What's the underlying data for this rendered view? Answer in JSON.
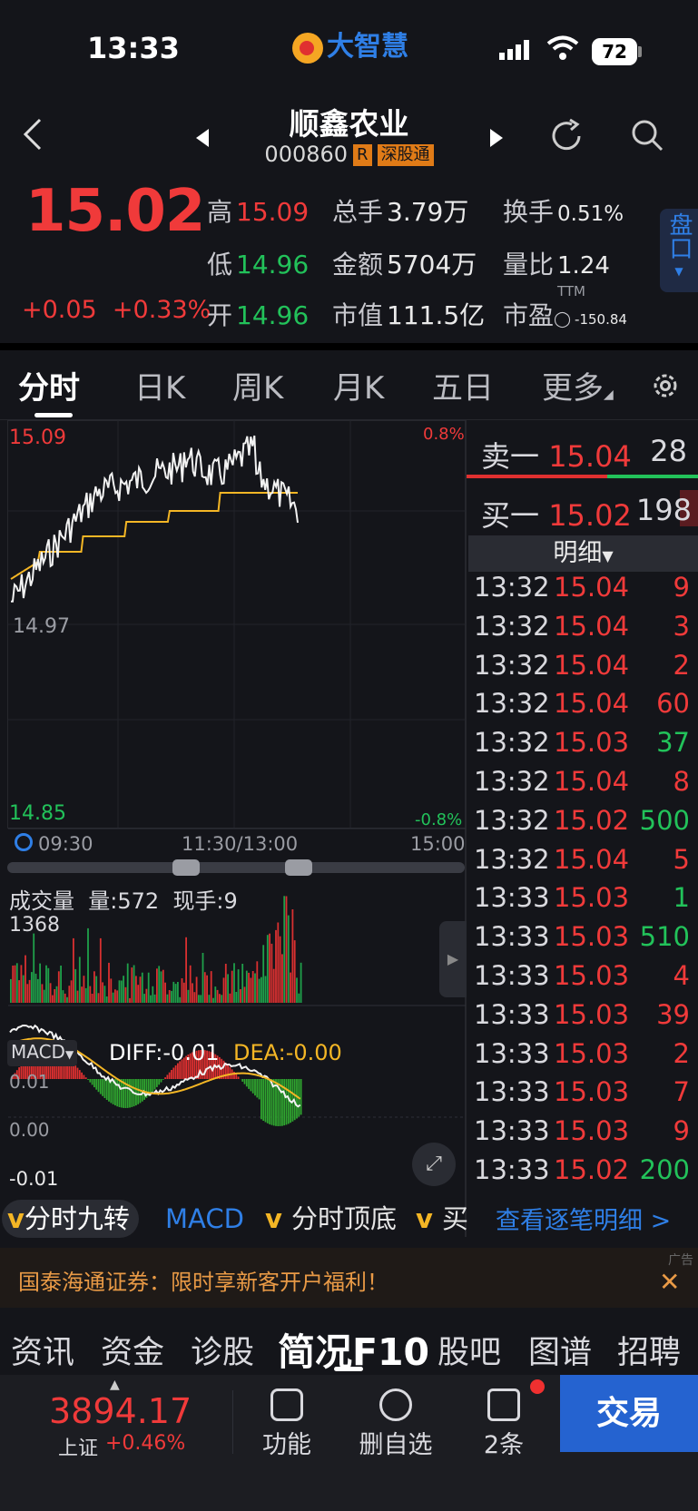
{
  "status_bar": {
    "time": "13:33",
    "brand": "大智慧",
    "battery": "72"
  },
  "header": {
    "title": "顺鑫农业",
    "code": "000860",
    "tag_r": "R",
    "tag_market": "深股通"
  },
  "quote": {
    "price": "15.02",
    "change": "+0.05",
    "change_pct": "+0.33%",
    "high_label": "高",
    "high": "15.09",
    "low_label": "低",
    "low": "14.96",
    "open_label": "开",
    "open": "14.96",
    "vol_label": "总手",
    "vol": "3.79万",
    "amount_label": "金额",
    "amount": "5704万",
    "cap_label": "市值",
    "cap": "111.5亿",
    "turnover_label": "换手",
    "turnover": "0.51%",
    "ratio_label": "量比",
    "ratio": "1.24",
    "pe_label": "市盈",
    "pe_tag": "TTM",
    "pe": "-150.84",
    "side_tab": "盘口"
  },
  "tabs": {
    "t1": "分时",
    "t2": "日K",
    "t3": "周K",
    "t4": "月K",
    "t5": "五日",
    "t6": "更多"
  },
  "chart": {
    "top_price": "15.09",
    "mid_price": "14.97",
    "bottom_price": "14.85",
    "top_pct": "0.8%",
    "bottom_pct": "-0.8%",
    "time_start": "09:30",
    "time_mid": "11:30/13:00",
    "time_end": "15:00",
    "vol_title": "成交量",
    "vol_amount": "量:572",
    "vol_now": "现手:9",
    "vol_max": "1368",
    "macd_label": "MACD",
    "diff": "DIFF:-0.01",
    "dea": "DEA:-0.00",
    "macd_top": "0.01",
    "macd_zero": "0.00",
    "macd_bottom": "-0.01"
  },
  "orderbook": {
    "sell_label": "卖一",
    "sell_price": "15.04",
    "sell_vol": "28",
    "buy_label": "买一",
    "buy_price": "15.02",
    "buy_vol": "198",
    "detail_label": "明细",
    "trades": [
      {
        "t": "13:32",
        "p": "15.04",
        "v": "9",
        "pc": "red",
        "vc": "red"
      },
      {
        "t": "13:32",
        "p": "15.04",
        "v": "3",
        "pc": "red",
        "vc": "red"
      },
      {
        "t": "13:32",
        "p": "15.04",
        "v": "2",
        "pc": "red",
        "vc": "red"
      },
      {
        "t": "13:32",
        "p": "15.04",
        "v": "60",
        "pc": "red",
        "vc": "red"
      },
      {
        "t": "13:32",
        "p": "15.03",
        "v": "37",
        "pc": "red",
        "vc": "green"
      },
      {
        "t": "13:32",
        "p": "15.04",
        "v": "8",
        "pc": "red",
        "vc": "red"
      },
      {
        "t": "13:32",
        "p": "15.02",
        "v": "500",
        "pc": "red",
        "vc": "green"
      },
      {
        "t": "13:32",
        "p": "15.04",
        "v": "5",
        "pc": "red",
        "vc": "red"
      },
      {
        "t": "13:33",
        "p": "15.03",
        "v": "1",
        "pc": "red",
        "vc": "green"
      },
      {
        "t": "13:33",
        "p": "15.03",
        "v": "510",
        "pc": "red",
        "vc": "green"
      },
      {
        "t": "13:33",
        "p": "15.03",
        "v": "4",
        "pc": "red",
        "vc": "red"
      },
      {
        "t": "13:33",
        "p": "15.03",
        "v": "39",
        "pc": "red",
        "vc": "red"
      },
      {
        "t": "13:33",
        "p": "15.03",
        "v": "2",
        "pc": "red",
        "vc": "red"
      },
      {
        "t": "13:33",
        "p": "15.03",
        "v": "7",
        "pc": "red",
        "vc": "red"
      },
      {
        "t": "13:33",
        "p": "15.03",
        "v": "9",
        "pc": "red",
        "vc": "red"
      },
      {
        "t": "13:33",
        "p": "15.02",
        "v": "200",
        "pc": "red",
        "vc": "green"
      }
    ],
    "more_link": "查看逐笔明细 >"
  },
  "indicator_pills": {
    "p1": "分时九转",
    "p2": "MACD",
    "p3": "分时顶底",
    "p4": "买"
  },
  "ad": {
    "text": "国泰海通证券：限时享新客开户福利！",
    "tag": "广告"
  },
  "bottom_nav": {
    "n1": "资讯",
    "n2": "资金",
    "n3": "诊股",
    "n4": "简况F10",
    "n5": "股吧",
    "n6": "图谱",
    "n7": "招聘"
  },
  "toolbar": {
    "index_value": "3894.17",
    "index_name": "上证",
    "index_change": "+0.46%",
    "func": "功能",
    "remove": "删自选",
    "msgs": "2条",
    "trade": "交易"
  },
  "colors": {
    "up": "#f03a3a",
    "down": "#22c25a",
    "avg": "#f4b625",
    "accent": "#2f7fe6"
  }
}
